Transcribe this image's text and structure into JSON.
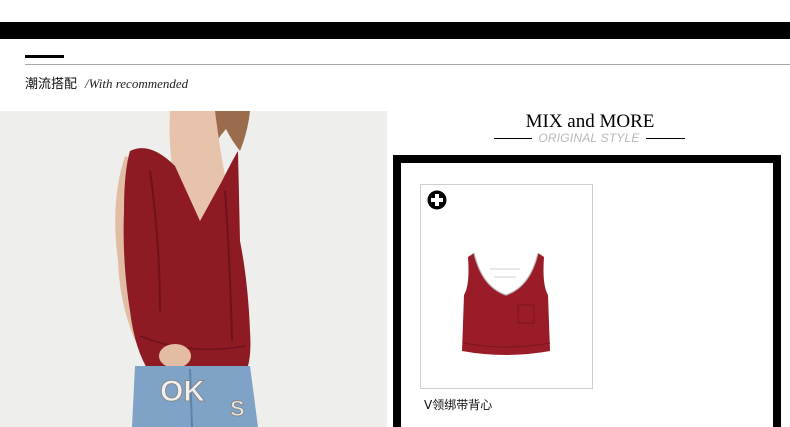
{
  "header": {
    "title_zh": "潮流搭配",
    "title_en": "/With recommended"
  },
  "mix": {
    "title": "MIX and MORE",
    "subtitle": "ORIGINAL STYLE"
  },
  "product": {
    "name": "V领绑带背心",
    "add_icon": "plus-circle-icon"
  },
  "colors": {
    "garment_red": "#8e1a24",
    "black": "#000000",
    "subtitle_gray": "#b8b8b8"
  }
}
